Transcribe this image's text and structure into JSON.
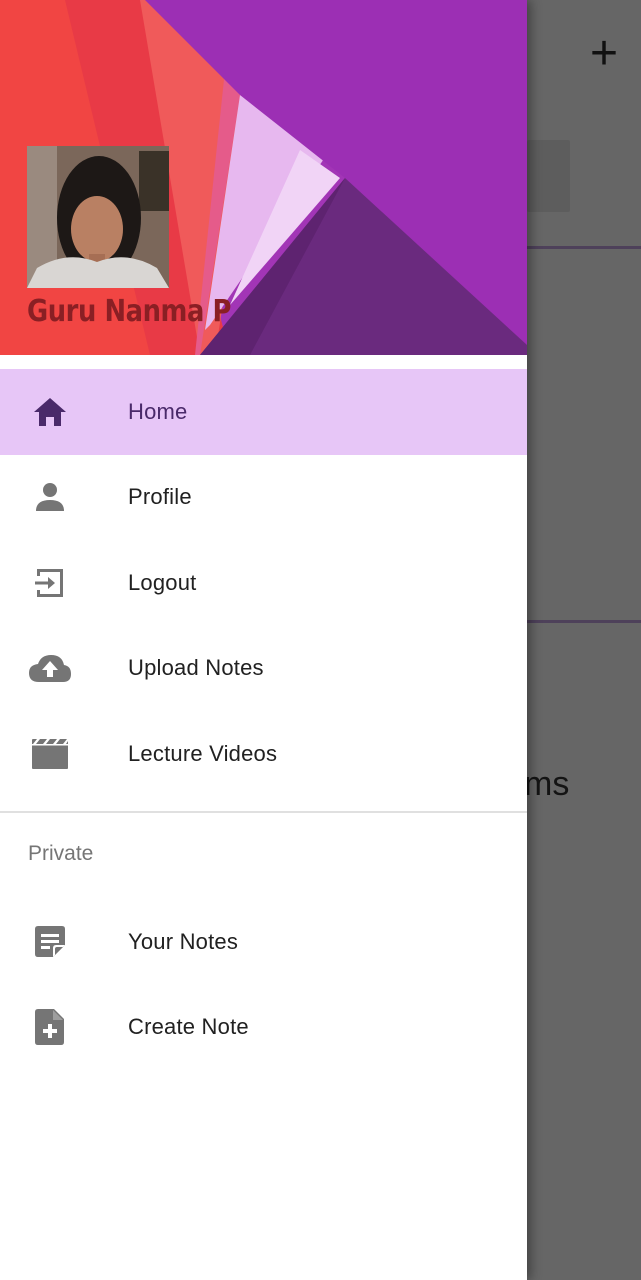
{
  "background_app": {
    "add_icon": "plus-icon",
    "partial_card_text": "ms"
  },
  "drawer": {
    "header": {
      "user_name": "Guru Nanma P",
      "avatar": "profile-photo"
    },
    "main_items": [
      {
        "label": "Home",
        "icon": "home-icon",
        "active": true
      },
      {
        "label": "Profile",
        "icon": "person-icon",
        "active": false
      },
      {
        "label": "Logout",
        "icon": "logout-icon",
        "active": false
      },
      {
        "label": "Upload Notes",
        "icon": "cloud-upload-icon",
        "active": false
      },
      {
        "label": "Lecture Videos",
        "icon": "movie-icon",
        "active": false
      }
    ],
    "section_title": "Private",
    "private_items": [
      {
        "label": "Your Notes",
        "icon": "notes-icon",
        "active": false
      },
      {
        "label": "Create Note",
        "icon": "note-add-icon",
        "active": false
      }
    ]
  },
  "colors": {
    "active_bg": "#e7c6f7",
    "icon_active": "#4a2a6a",
    "icon_default": "#757575",
    "header_purple": "#9b2fb0",
    "header_red": "#f0423f",
    "name_color": "#8a1f24"
  }
}
